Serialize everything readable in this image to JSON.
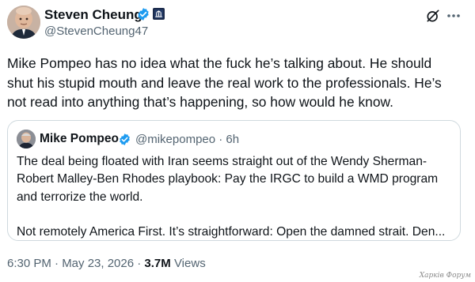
{
  "author": {
    "name": "Steven Cheung",
    "handle": "@StevenCheung47"
  },
  "tweet": {
    "text": "Mike Pompeo has no idea what the fuck he’s talking about. He should\nshut his stupid mouth and leave the real work to the professionals. He’s\nnot read into anything that’s happening, so how would he know."
  },
  "quote": {
    "name": "Mike Pompeo",
    "handle_time": "@mikepompeo · 6h",
    "text": "The deal being floated with Iran seems straight out of the Wendy Sherman-\nRobert Malley-Ben Rhodes playbook: Pay the IRGC to build a WMD program\nand terrorize the world.\n\nNot remotely America First. It’s straightforward: Open the damned strait. Den..."
  },
  "meta": {
    "timestamp": "6:30 PM · May 23, 2026 · ",
    "views_count": "3.7M",
    "views_label": " Views"
  },
  "watermark": "Харків Форум",
  "colors": {
    "verified": "#1d9bf0",
    "secondary_text": "#536471",
    "border": "#cfd9de"
  },
  "icons": {
    "verified": "verified-check-icon",
    "affiliation": "government-affiliation-icon",
    "grok": "grok-icon",
    "more": "more-dots-icon"
  }
}
